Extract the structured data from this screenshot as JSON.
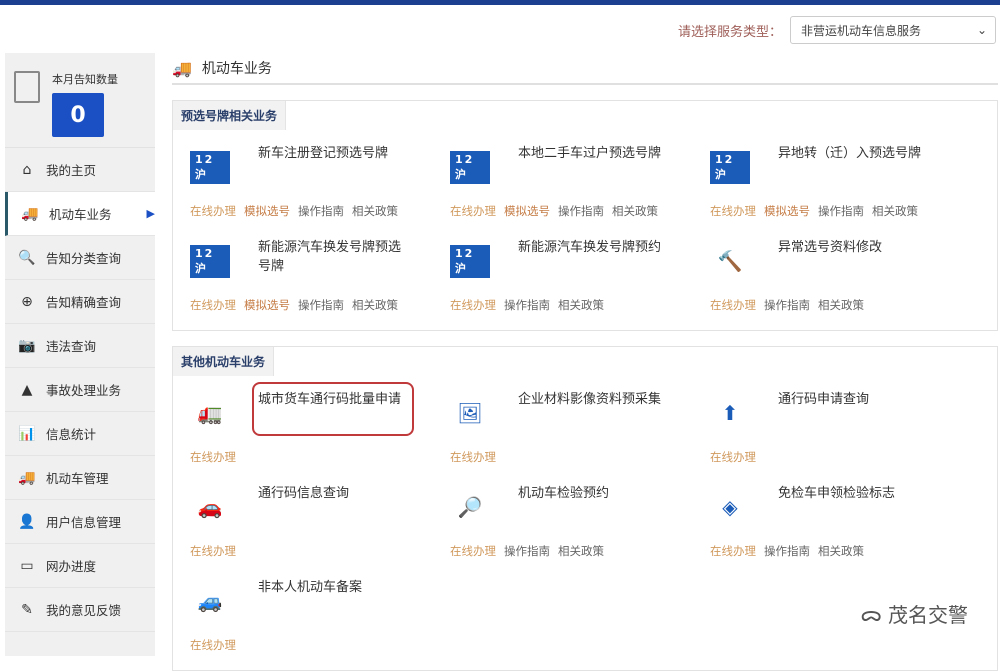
{
  "selector": {
    "label": "请选择服务类型：",
    "value": "非营运机动车信息服务"
  },
  "sidebar": {
    "count_label": "本月告知数量",
    "count": "0",
    "items": [
      {
        "label": "我的主页",
        "icon": "home-icon",
        "glyph": "⌂"
      },
      {
        "label": "机动车业务",
        "icon": "truck-icon",
        "glyph": "🚚",
        "active": true
      },
      {
        "label": "告知分类查询",
        "icon": "search-icon",
        "glyph": "🔍"
      },
      {
        "label": "告知精确查询",
        "icon": "zoom-in-icon",
        "glyph": "⊕"
      },
      {
        "label": "违法查询",
        "icon": "camera-icon",
        "glyph": "📷"
      },
      {
        "label": "事故处理业务",
        "icon": "warning-icon",
        "glyph": "▲"
      },
      {
        "label": "信息统计",
        "icon": "bar-chart-icon",
        "glyph": "📊"
      },
      {
        "label": "机动车管理",
        "icon": "truck-icon",
        "glyph": "🚚"
      },
      {
        "label": "用户信息管理",
        "icon": "user-icon",
        "glyph": "👤"
      },
      {
        "label": "网办进度",
        "icon": "progress-icon",
        "glyph": "▭"
      },
      {
        "label": "我的意见反馈",
        "icon": "feedback-icon",
        "glyph": "✎"
      }
    ]
  },
  "main": {
    "title": "机动车业务",
    "panels": [
      {
        "title": "预选号牌相关业务",
        "items": [
          {
            "name": "新车注册登记预选号牌",
            "links": [
              "在线办理",
              "模拟选号",
              "操作指南",
              "相关政策"
            ]
          },
          {
            "name": "本地二手车过户预选号牌",
            "links": [
              "在线办理",
              "模拟选号",
              "操作指南",
              "相关政策"
            ]
          },
          {
            "name": "异地转（迁）入预选号牌",
            "links": [
              "在线办理",
              "模拟选号",
              "操作指南",
              "相关政策"
            ]
          },
          {
            "name": "新能源汽车换发号牌预选号牌",
            "links": [
              "在线办理",
              "模拟选号",
              "操作指南",
              "相关政策"
            ]
          },
          {
            "name": "新能源汽车换发号牌预约",
            "links": [
              "在线办理",
              "操作指南",
              "相关政策"
            ]
          },
          {
            "name": "异常选号资料修改",
            "links": [
              "在线办理",
              "操作指南",
              "相关政策"
            ]
          }
        ]
      },
      {
        "title": "其他机动车业务",
        "items": [
          {
            "name": "城市货车通行码批量申请",
            "links": [
              "在线办理"
            ],
            "highlight": true
          },
          {
            "name": "企业材料影像资料预采集",
            "links": [
              "在线办理"
            ]
          },
          {
            "name": "通行码申请查询",
            "links": [
              "在线办理"
            ]
          },
          {
            "name": "通行码信息查询",
            "links": [
              "在线办理"
            ]
          },
          {
            "name": "机动车检验预约",
            "links": [
              "在线办理",
              "操作指南",
              "相关政策"
            ]
          },
          {
            "name": "免检车申领检验标志",
            "links": [
              "在线办理",
              "操作指南",
              "相关政策"
            ]
          },
          {
            "name": "非本人机动车备案",
            "links": [
              "在线办理"
            ]
          }
        ]
      }
    ]
  },
  "plate_text": "12沪",
  "watermark": "茂名交警"
}
